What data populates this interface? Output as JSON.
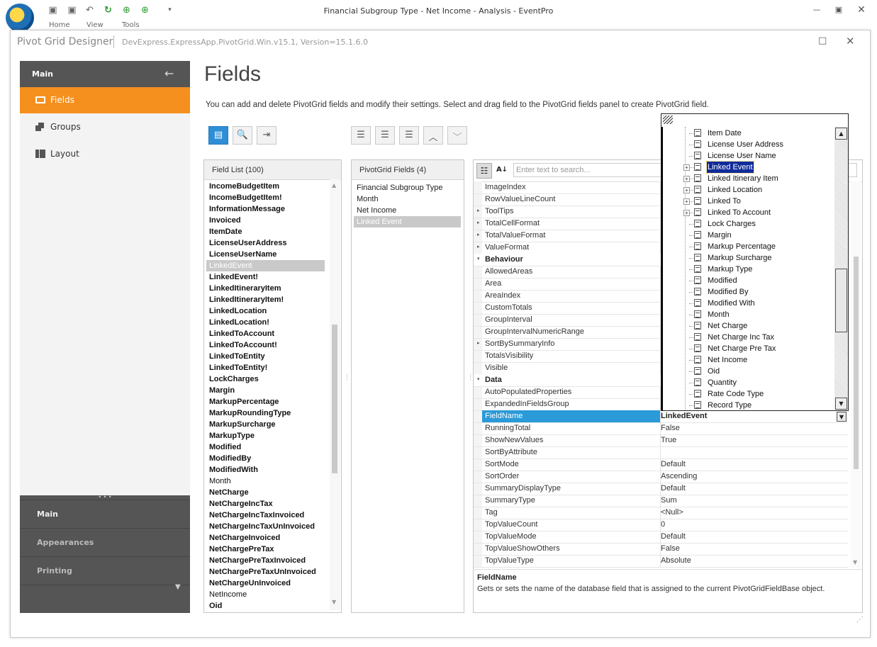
{
  "app": {
    "title": "Financial Subgroup Type - Net Income - Analysis - EventPro",
    "tabs": [
      "Home",
      "View",
      "Tools"
    ]
  },
  "dialog": {
    "title": "Pivot Grid Designer",
    "version": "DevExpress.ExpressApp.PivotGrid.Win.v15.1, Version=15.1.6.0"
  },
  "nav": {
    "header": "Main",
    "items": [
      {
        "label": "Fields",
        "icon": "fields-icon",
        "selected": true
      },
      {
        "label": "Groups",
        "icon": "groups-icon",
        "selected": false
      },
      {
        "label": "Layout",
        "icon": "layout-icon",
        "selected": false
      }
    ],
    "groups": [
      "Main",
      "Appearances",
      "Printing"
    ]
  },
  "page": {
    "title": "Fields",
    "description": "You can add and delete PivotGrid fields and modify their settings. Select and drag field to the PivotGrid fields panel to create PivotGrid field."
  },
  "field_list": {
    "header": "Field List (100)",
    "items": [
      {
        "t": "IncomeBudgetItem",
        "b": true
      },
      {
        "t": "IncomeBudgetItem!",
        "b": true
      },
      {
        "t": "InformationMessage",
        "b": true
      },
      {
        "t": "Invoiced",
        "b": true
      },
      {
        "t": "ItemDate",
        "b": true
      },
      {
        "t": "LicenseUserAddress",
        "b": true
      },
      {
        "t": "LicenseUserName",
        "b": true
      },
      {
        "t": "LinkedEvent",
        "b": false,
        "sel": true
      },
      {
        "t": "LinkedEvent!",
        "b": true
      },
      {
        "t": "LinkedItineraryItem",
        "b": true
      },
      {
        "t": "LinkedItineraryItem!",
        "b": true
      },
      {
        "t": "LinkedLocation",
        "b": true
      },
      {
        "t": "LinkedLocation!",
        "b": true
      },
      {
        "t": "LinkedToAccount",
        "b": true
      },
      {
        "t": "LinkedToAccount!",
        "b": true
      },
      {
        "t": "LinkedToEntity",
        "b": true
      },
      {
        "t": "LinkedToEntity!",
        "b": true
      },
      {
        "t": "LockCharges",
        "b": true
      },
      {
        "t": "Margin",
        "b": true
      },
      {
        "t": "MarkupPercentage",
        "b": true
      },
      {
        "t": "MarkupRoundingType",
        "b": true
      },
      {
        "t": "MarkupSurcharge",
        "b": true
      },
      {
        "t": "MarkupType",
        "b": true
      },
      {
        "t": "Modified",
        "b": true
      },
      {
        "t": "ModifiedBy",
        "b": true
      },
      {
        "t": "ModifiedWith",
        "b": true
      },
      {
        "t": "Month",
        "b": false
      },
      {
        "t": "NetCharge",
        "b": true
      },
      {
        "t": "NetChargeIncTax",
        "b": true
      },
      {
        "t": "NetChargeIncTaxInvoiced",
        "b": true
      },
      {
        "t": "NetChargeIncTaxUnInvoiced",
        "b": true
      },
      {
        "t": "NetChargeInvoiced",
        "b": true
      },
      {
        "t": "NetChargePreTax",
        "b": true
      },
      {
        "t": "NetChargePreTaxInvoiced",
        "b": true
      },
      {
        "t": "NetChargePreTaxUnInvoiced",
        "b": true
      },
      {
        "t": "NetChargeUnInvoiced",
        "b": true
      },
      {
        "t": "NetIncome",
        "b": false
      },
      {
        "t": "Oid",
        "b": true
      }
    ]
  },
  "pivot_fields": {
    "header": "PivotGrid Fields (4)",
    "items": [
      {
        "t": "Financial Subgroup Type"
      },
      {
        "t": "Month"
      },
      {
        "t": "Net Income"
      },
      {
        "t": "Linked Event",
        "sel": true
      }
    ]
  },
  "property_grid": {
    "search_placeholder": "Enter text to search...",
    "rows": [
      {
        "n": "ImageIndex",
        "v": ""
      },
      {
        "n": "RowValueLineCount",
        "v": ""
      },
      {
        "n": "ToolTips",
        "v": "",
        "exp": "▸"
      },
      {
        "n": "TotalCellFormat",
        "v": "",
        "exp": "▸"
      },
      {
        "n": "TotalValueFormat",
        "v": "",
        "exp": "▸"
      },
      {
        "n": "ValueFormat",
        "v": "",
        "exp": "▸"
      },
      {
        "n": "Behaviour",
        "v": "",
        "cat": true,
        "exp": "▾"
      },
      {
        "n": "AllowedAreas",
        "v": ""
      },
      {
        "n": "Area",
        "v": ""
      },
      {
        "n": "AreaIndex",
        "v": ""
      },
      {
        "n": "CustomTotals",
        "v": ""
      },
      {
        "n": "GroupInterval",
        "v": ""
      },
      {
        "n": "GroupIntervalNumericRange",
        "v": ""
      },
      {
        "n": "SortBySummaryInfo",
        "v": "",
        "exp": "▸"
      },
      {
        "n": "TotalsVisibility",
        "v": ""
      },
      {
        "n": "Visible",
        "v": ""
      },
      {
        "n": "Data",
        "v": "",
        "cat": true,
        "exp": "▾"
      },
      {
        "n": "AutoPopulatedProperties",
        "v": ""
      },
      {
        "n": "ExpandedInFieldsGroup",
        "v": ""
      },
      {
        "n": "FieldName",
        "v": "LinkedEvent",
        "sel": true
      },
      {
        "n": "RunningTotal",
        "v": "False"
      },
      {
        "n": "ShowNewValues",
        "v": "True"
      },
      {
        "n": "SortByAttribute",
        "v": ""
      },
      {
        "n": "SortMode",
        "v": "Default"
      },
      {
        "n": "SortOrder",
        "v": "Ascending"
      },
      {
        "n": "SummaryDisplayType",
        "v": "Default"
      },
      {
        "n": "SummaryType",
        "v": "Sum"
      },
      {
        "n": "Tag",
        "v": "<Null>"
      },
      {
        "n": "TopValueCount",
        "v": "0"
      },
      {
        "n": "TopValueMode",
        "v": "Default"
      },
      {
        "n": "TopValueShowOthers",
        "v": "False"
      },
      {
        "n": "TopValueType",
        "v": "Absolute"
      }
    ],
    "description_title": "FieldName",
    "description_text": "Gets or sets the name of the database field that is assigned to the current PivotGridFieldBase object."
  },
  "dropdown": {
    "items": [
      {
        "t": "Item Date"
      },
      {
        "t": "License User Address"
      },
      {
        "t": "License User Name"
      },
      {
        "t": "Linked Event",
        "plus": true,
        "sel": true
      },
      {
        "t": "Linked Itinerary Item",
        "plus": true
      },
      {
        "t": "Linked Location",
        "plus": true
      },
      {
        "t": "Linked To",
        "plus": true
      },
      {
        "t": "Linked To Account",
        "plus": true
      },
      {
        "t": "Lock Charges"
      },
      {
        "t": "Margin"
      },
      {
        "t": "Markup Percentage"
      },
      {
        "t": "Markup Surcharge"
      },
      {
        "t": "Markup Type"
      },
      {
        "t": "Modified"
      },
      {
        "t": "Modified By"
      },
      {
        "t": "Modified With"
      },
      {
        "t": "Month"
      },
      {
        "t": "Net Charge"
      },
      {
        "t": "Net Charge Inc Tax"
      },
      {
        "t": "Net Charge Pre Tax"
      },
      {
        "t": "Net Income"
      },
      {
        "t": "Oid"
      },
      {
        "t": "Quantity"
      },
      {
        "t": "Rate Code Type"
      },
      {
        "t": "Record Type"
      }
    ]
  }
}
